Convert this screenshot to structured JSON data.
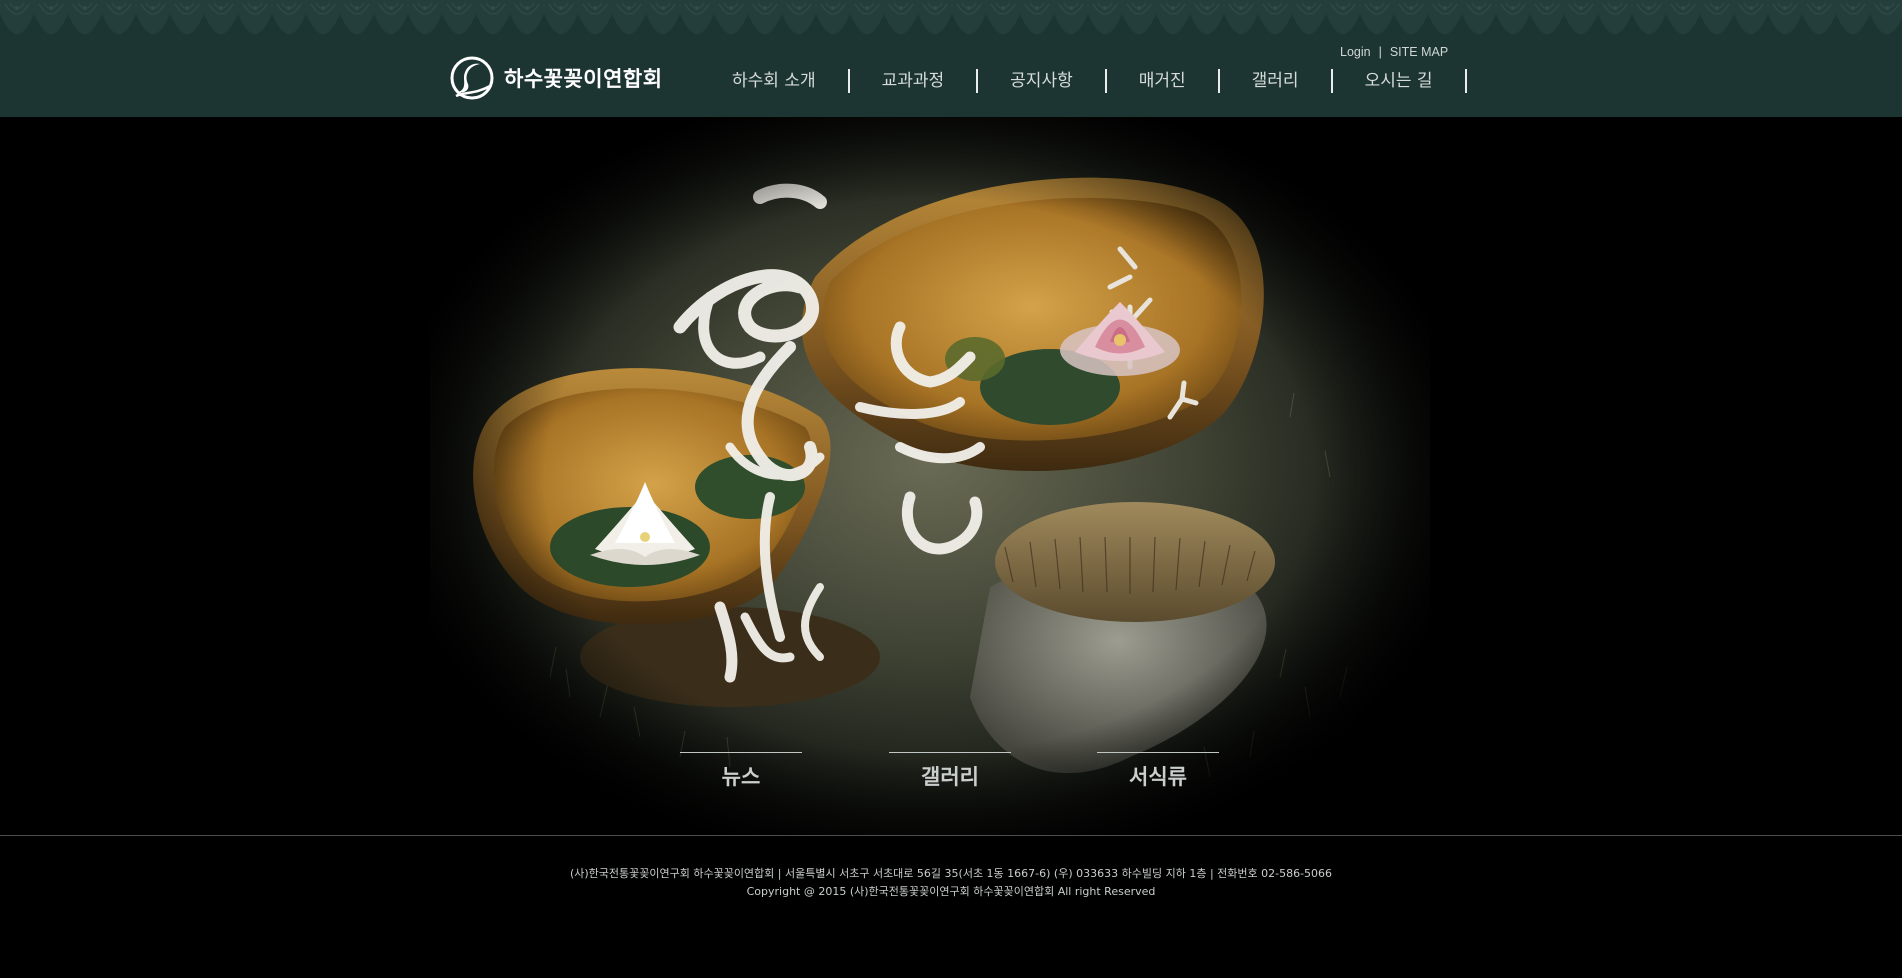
{
  "header": {
    "logo_text": "하수꽃꽂이연합회",
    "util": {
      "login": "Login",
      "separator": "|",
      "sitemap": "SITE MAP"
    },
    "nav": [
      {
        "label": "하수회 소개"
      },
      {
        "label": "교과과정"
      },
      {
        "label": "공지사항"
      },
      {
        "label": "매거진"
      },
      {
        "label": "갤러리"
      },
      {
        "label": "오시는 길"
      }
    ]
  },
  "hero": {
    "image": "calligraphy-over-two-wooden-bowls-with-water-lilies",
    "quick_links": [
      {
        "label": "뉴스"
      },
      {
        "label": "갤러리"
      },
      {
        "label": "서식류"
      }
    ]
  },
  "footer": {
    "address": "(사)한국전통꽃꽂이연구회 하수꽃꽂이연합회  |  서울특별시 서초구 서초대로 56길 35(서초 1동 1667-6)  (우) 033633 하수빌딩 지하 1층   |   전화번호 02-586-5066",
    "copyright": "Copyright @ 2015 (사)한국전통꽃꽂이연구회 하수꽃꽂이연합회 All right Reserved"
  },
  "colors": {
    "header_bg": "#1c3532",
    "page_bg": "#000000",
    "nav_text": "#d7dcdb"
  }
}
